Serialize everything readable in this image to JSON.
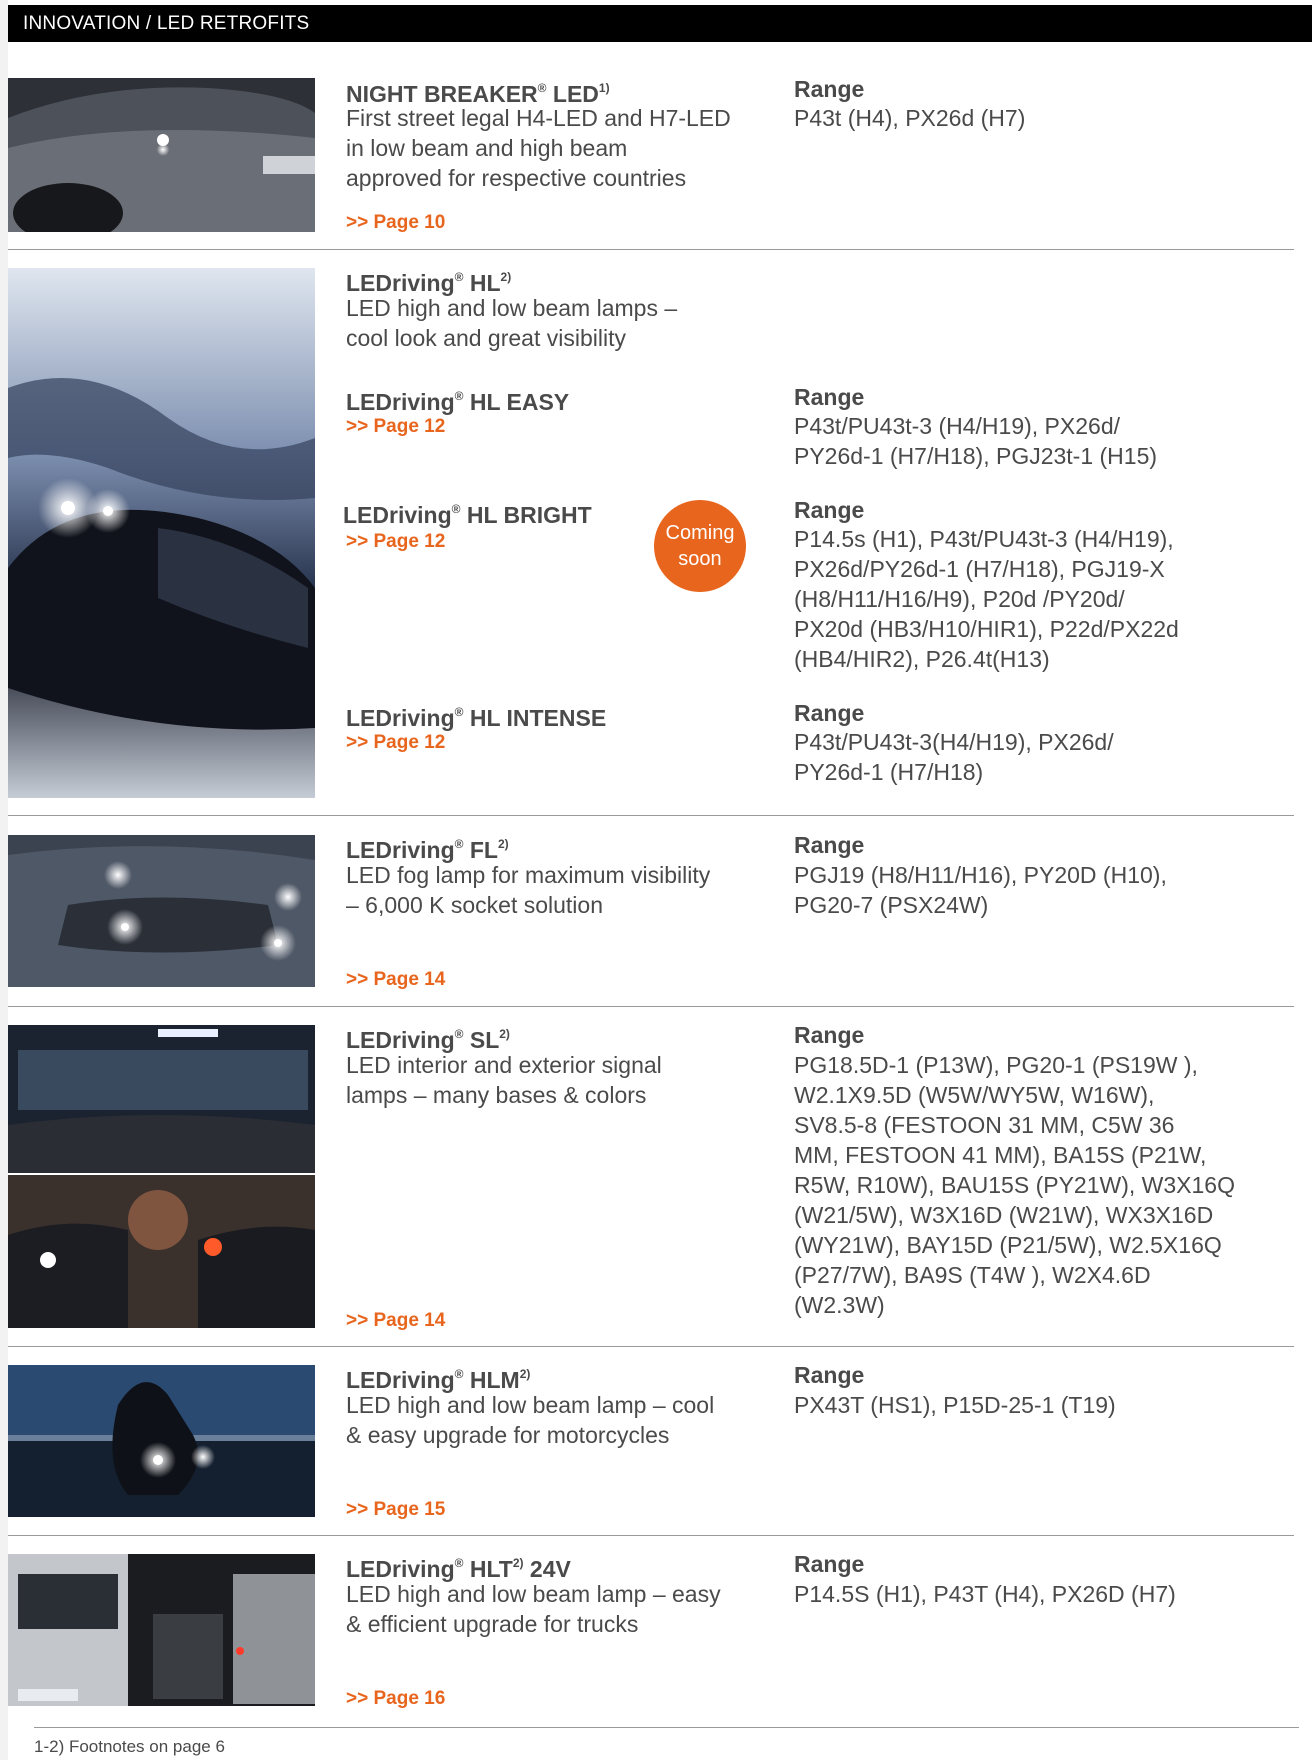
{
  "header": {
    "section_title": "INNOVATION / LED RETROFITS"
  },
  "products": [
    {
      "name": "NIGHT BREAKER",
      "suffix": " LED",
      "sup": "1)",
      "description": [
        "First street legal H4-LED and H7-LED",
        "in low beam and high beam",
        "approved for respective countries"
      ],
      "link": ">> Page 10",
      "range_label": "Range",
      "range": [
        "P43t (H4), PX26d (H7)"
      ]
    },
    {
      "name": "LEDriving",
      "suffix": " HL",
      "sup": "2)",
      "description": [
        "LED high and low beam lamps –",
        "cool look and great visibility"
      ],
      "variants": [
        {
          "name": "LEDriving",
          "suffix": " HL EASY",
          "link": ">> Page 12",
          "range_label": "Range",
          "range": [
            "P43t/PU43t-3 (H4/H19), PX26d/",
            "PY26d-1 (H7/H18), PGJ23t-1 (H15)"
          ]
        },
        {
          "name": "LEDriving",
          "suffix": " HL BRIGHT",
          "link": ">> Page 12",
          "range_label": "Range",
          "badge": [
            "Coming",
            "soon"
          ],
          "range": [
            "P14.5s (H1), P43t/PU43t-3 (H4/H19),",
            "PX26d/PY26d-1 (H7/H18), PGJ19-X",
            "(H8/H11/H16/H9), P20d /PY20d/",
            "PX20d (HB3/H10/HIR1), P22d/PX22d",
            "(HB4/HIR2), P26.4t(H13)"
          ]
        },
        {
          "name": "LEDriving",
          "suffix": " HL INTENSE",
          "link": ">> Page 12",
          "range_label": "Range",
          "range": [
            "P43t/PU43t-3(H4/H19), PX26d/",
            "PY26d-1 (H7/H18)"
          ]
        }
      ]
    },
    {
      "name": "LEDriving",
      "suffix": " FL",
      "sup": "2)",
      "description": [
        "LED fog lamp for maximum visibility",
        "– 6,000 K socket solution"
      ],
      "link": ">> Page 14",
      "range_label": "Range",
      "range": [
        "PGJ19 (H8/H11/H16), PY20D (H10),",
        "PG20-7 (PSX24W)"
      ]
    },
    {
      "name": "LEDriving",
      "suffix": " SL",
      "sup": "2)",
      "description": [
        "LED interior and exterior signal",
        "lamps – many bases & colors"
      ],
      "link": ">> Page 14",
      "range_label": "Range",
      "range": [
        "PG18.5D-1 (P13W), PG20-1 (PS19W ),",
        "W2.1X9.5D (W5W/WY5W, W16W),",
        "SV8.5-8 (FESTOON 31 MM, C5W 36",
        "MM, FESTOON 41 MM), BA15S (P21W,",
        "R5W, R10W), BAU15S (PY21W), W3X16Q",
        "(W21/5W), W3X16D (W21W), WX3X16D",
        "(WY21W), BAY15D (P21/5W), W2.5X16Q",
        "(P27/7W), BA9S (T4W ), W2X4.6D",
        "(W2.3W)"
      ]
    },
    {
      "name": "LEDriving",
      "suffix": " HLM",
      "sup": "2)",
      "description": [
        "LED high and low beam lamp – cool",
        "& easy upgrade for motorcycles"
      ],
      "link": ">> Page 15",
      "range_label": "Range",
      "range": [
        "PX43T (HS1), P15D-25-1 (T19)"
      ]
    },
    {
      "name": "LEDriving",
      "suffix": " HLT",
      "sup": "2)",
      "post": " 24V",
      "description": [
        "LED high and low beam lamp – easy",
        "& efficient upgrade for trucks"
      ],
      "link": ">> Page 16",
      "range_label": "Range",
      "range": [
        "P14.5S (H1), P43T (H4), PX26D (H7)"
      ]
    }
  ],
  "reg": "®",
  "footnote": "1-2) Footnotes on page 6",
  "colors": {
    "accent": "#e8651d",
    "header_bg": "#000000",
    "text": "#4a4a4a"
  }
}
